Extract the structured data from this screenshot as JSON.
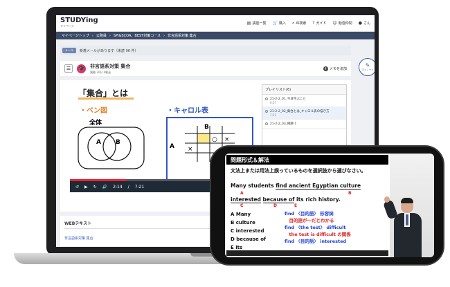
{
  "header": {
    "logo": "STUDYing",
    "logo_sub": "マイページ",
    "nav": [
      {
        "label": "講座一覧",
        "icon": "book-icon"
      },
      {
        "label": "購入",
        "icon": "cart-icon"
      },
      {
        "label": "AI検索",
        "icon": "search-icon"
      },
      {
        "label": "ガイド",
        "icon": "help-icon"
      },
      {
        "label": "勉強仲間",
        "icon": "people-icon"
      },
      {
        "label": "さん",
        "icon": "user-icon"
      }
    ]
  },
  "breadcrumb": [
    "マイページトップ",
    "公務員",
    "SPI&SCOA、BEST対策コース",
    "非言語系対策 集合"
  ],
  "mail": {
    "badge": "メール",
    "text": "新着メールがあります（未読 96 件）"
  },
  "lesson": {
    "title": "非言語系対策 集合",
    "meta": "講義 30分 6動画",
    "memo_label": "メモを追加"
  },
  "mypage_button": "マイノート",
  "slide": {
    "title": "「集合」とは",
    "venn_title": "・ベン図",
    "carroll_title": "・キャロル表",
    "venn_whole": "全体",
    "venn_a": "A",
    "venn_b": "B",
    "carroll_a": "A",
    "carroll_b": "B",
    "carroll_cells": [
      [
        "○",
        "×"
      ],
      [
        "×",
        ""
      ]
    ]
  },
  "player": {
    "current": "2:14",
    "total": "7:21",
    "progress": 0.3
  },
  "playlist": {
    "header": "プレイリスト(6)",
    "items": [
      {
        "title": "21-2-2_01_今日学ぶこと",
        "time": "0:57"
      },
      {
        "title": "21-2-2_02_集合とは_キャロル表の描き方",
        "time": "7:21"
      },
      {
        "title": "21-2-2_03_例題 1",
        "time": ""
      }
    ]
  },
  "webtext": {
    "heading": "WEBテキスト",
    "link": "非言語系対策 集合"
  },
  "phone_lecture": {
    "header": "問題形式＆解法",
    "instruction": "文法上または用法上誤っているものを選択肢から選びなさい。",
    "sentence1": [
      "Many students ",
      "find ancient Egyptian culture"
    ],
    "sentence2": [
      "interested",
      " ",
      "because of",
      " its rich history."
    ],
    "labels": [
      "A",
      "B",
      "C",
      "D",
      "E"
    ],
    "choices": [
      "A Many",
      "B culture",
      "C interested",
      "D because of",
      "E its"
    ],
    "notes": [
      {
        "text": "find 〈目的語〉 形容詞",
        "color": "blue"
      },
      {
        "text": "　目的語が～だとわかる",
        "color": "red"
      },
      {
        "text": "find 〈the test〉 difficult",
        "color": "blue"
      },
      {
        "text": "　the test is difficult の関係",
        "color": "red"
      },
      {
        "text": "find 〈目的語〉 interested",
        "color": "blue"
      }
    ]
  }
}
